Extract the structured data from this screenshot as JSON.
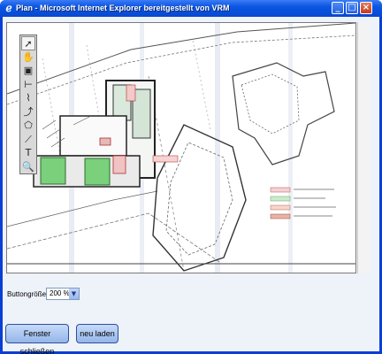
{
  "window": {
    "title": "Plan - Microsoft Internet Explorer bereitgestellt von VRM",
    "app_icon": "ie-icon",
    "buttons": {
      "minimize": "minimize-icon",
      "maximize": "maximize-icon",
      "close": "close-icon"
    }
  },
  "map": {
    "legend": "legend-swatches",
    "tools": [
      {
        "name": "select-arrow-icon",
        "glyph": "➚",
        "active": true
      },
      {
        "name": "pan-hand-icon",
        "glyph": "✋"
      },
      {
        "name": "zoom-window-icon",
        "glyph": "▣"
      },
      {
        "name": "measure-distance-icon",
        "glyph": "⊢"
      },
      {
        "name": "polyline-icon",
        "glyph": "⌇"
      },
      {
        "name": "curve-icon",
        "glyph": "⤴"
      },
      {
        "name": "polygon-icon",
        "glyph": "⬠"
      },
      {
        "name": "line-icon",
        "glyph": "⟋"
      },
      {
        "name": "text-tool-icon",
        "glyph": "T"
      },
      {
        "name": "magnifier-icon",
        "glyph": "🔍"
      }
    ]
  },
  "controls": {
    "button_size_label": "Buttongröße:",
    "button_size_value": "200 %",
    "close_window_label": "Fenster schließen",
    "reload_label": "neu laden"
  },
  "colors": {
    "titlebar": "#0a56e3",
    "window_bg": "#eef2f9",
    "green_area": "#7bd07b"
  }
}
